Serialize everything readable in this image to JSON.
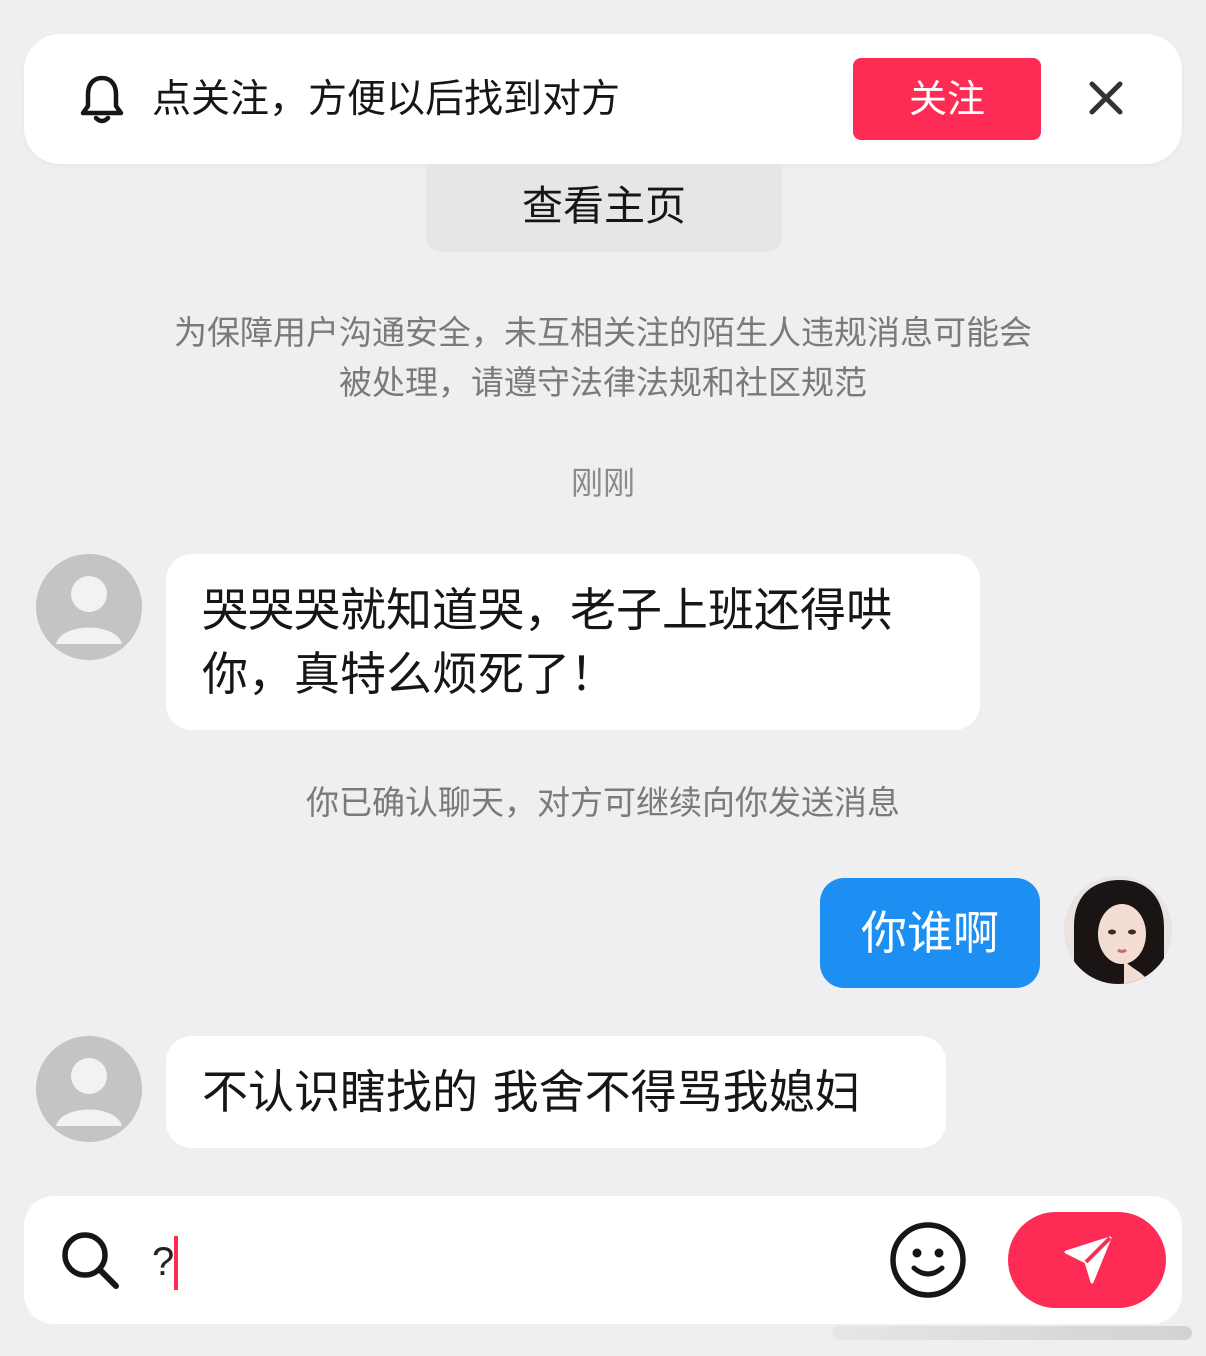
{
  "banner": {
    "text": "点关注，方便以后找到对方",
    "follow_label": "关注"
  },
  "view_profile_label": "查看主页",
  "notice": {
    "line1": "为保障用户沟通安全，未互相关注的陌生人违规消息可能会",
    "line2": "被处理，请遵守法律法规和社区规范"
  },
  "timestamp": "刚刚",
  "messages": [
    {
      "from": "other",
      "line1": "哭哭哭就知道哭，老子上班还得哄",
      "line2": "你，真特么烦死了！"
    },
    {
      "from": "me",
      "text": "你谁啊"
    },
    {
      "from": "other",
      "text": "不认识瞎找的 我舍不得骂我媳妇"
    }
  ],
  "system_confirm": "你已确认聊天，对方可继续向你发送消息",
  "composer": {
    "value": "?"
  },
  "colors": {
    "accent": "#fe2c55",
    "outgoing_bubble": "#1d8ff2",
    "background": "#efeff1"
  },
  "icons": [
    "bell-icon",
    "close-icon",
    "search-icon",
    "emoji-icon",
    "send-icon"
  ]
}
